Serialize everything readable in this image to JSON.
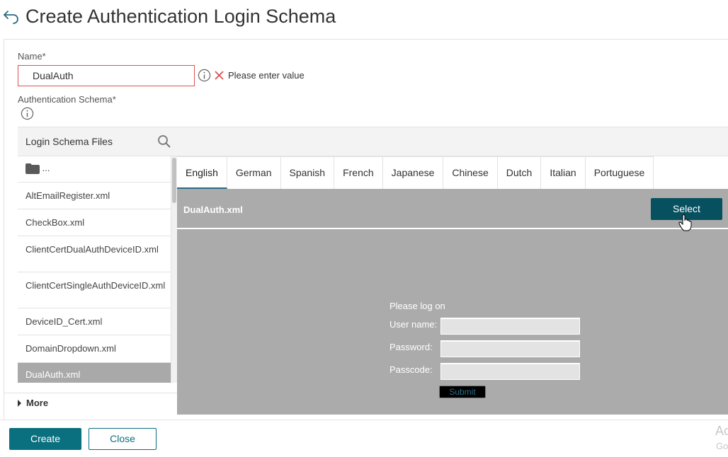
{
  "header": {
    "title": "Create Authentication Login Schema"
  },
  "form": {
    "name_label": "Name*",
    "name_value": "DualAuth",
    "error_text": "Please enter value",
    "schema_label": "Authentication Schema*"
  },
  "files": {
    "header": "Login Schema Files",
    "folder_label": "...",
    "items": [
      "AltEmailRegister.xml",
      "CheckBox.xml",
      "ClientCertDualAuthDeviceID.xml",
      "ClientCertSingleAuthDeviceID.xml",
      "DeviceID_Cert.xml",
      "DomainDropdown.xml",
      "DualAuth.xml"
    ],
    "selected": "DualAuth.xml"
  },
  "tabs": [
    "English",
    "German",
    "Spanish",
    "French",
    "Japanese",
    "Chinese",
    "Dutch",
    "Italian",
    "Portuguese"
  ],
  "active_tab": "English",
  "preview": {
    "file_name": "DualAuth.xml",
    "select_label": "Select",
    "login_title": "Please log on",
    "fields": [
      "User name:",
      "Password:",
      "Passcode:"
    ],
    "submit_label": "Submit"
  },
  "more_label": "More",
  "footer": {
    "create_label": "Create",
    "close_label": "Close",
    "watermark_line1": "Ac",
    "watermark_line2": "Go"
  },
  "colors": {
    "primary": "#0a6f7e",
    "select_button": "#07505f",
    "error": "#d9534f",
    "preview_background": "#ababab"
  }
}
